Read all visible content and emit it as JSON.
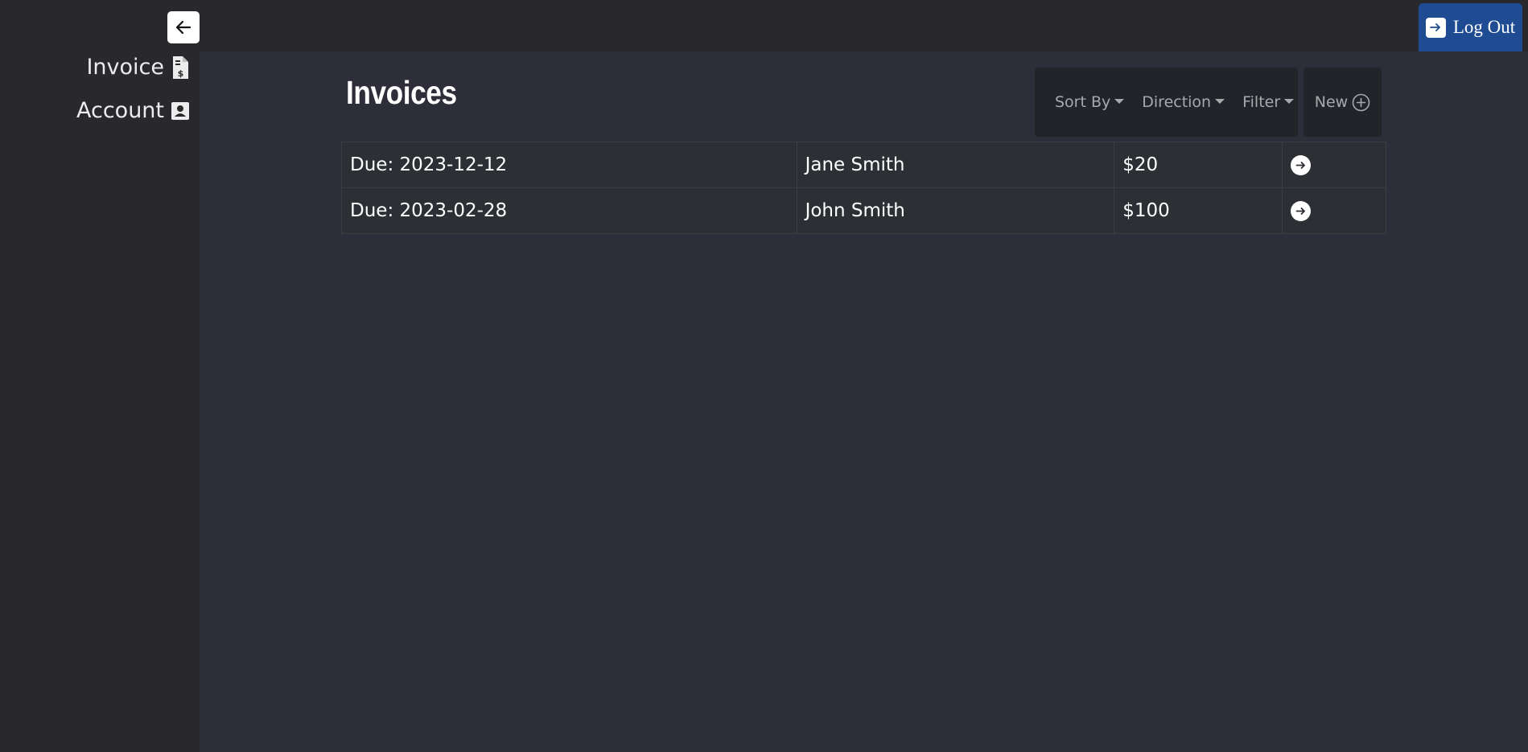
{
  "header": {
    "logout_label": "Log Out"
  },
  "sidebar": {
    "items": [
      {
        "label": "Invoice",
        "icon": "invoice-dollar-icon"
      },
      {
        "label": "Account",
        "icon": "contact-card-icon"
      }
    ]
  },
  "main": {
    "title": "Invoices",
    "controls": {
      "sort_label": "Sort By",
      "direction_label": "Direction",
      "filter_label": "Filter",
      "new_label": "New"
    },
    "invoices": [
      {
        "due": "Due: 2023-12-12",
        "name": "Jane Smith",
        "amount": "$20"
      },
      {
        "due": "Due: 2023-02-28",
        "name": "John Smith",
        "amount": "$100"
      }
    ]
  },
  "colors": {
    "accent": "#1e4b91",
    "background": "#2e2e3a",
    "sidebar": "#29282d",
    "panel": "#212429"
  }
}
